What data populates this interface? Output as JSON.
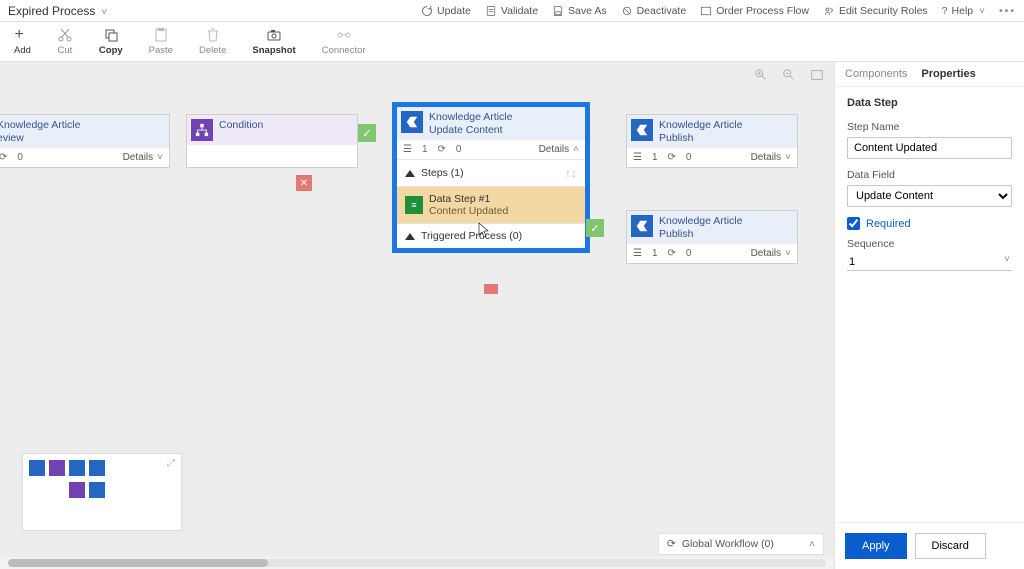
{
  "process": {
    "title": "Expired Process"
  },
  "topbar": {
    "update": "Update",
    "validate": "Validate",
    "saveas": "Save As",
    "deactivate": "Deactivate",
    "orderflow": "Order Process Flow",
    "editroles": "Edit Security Roles",
    "help": "Help"
  },
  "ribbon": {
    "add": "Add",
    "cut": "Cut",
    "copy": "Copy",
    "paste": "Paste",
    "delete": "Delete",
    "snapshot": "Snapshot",
    "connector": "Connector"
  },
  "nodes": {
    "review": {
      "title1": "Knowledge Article",
      "title2": "eview",
      "details": "Details"
    },
    "condition": {
      "title1": "Condition"
    },
    "update": {
      "title1": "Knowledge Article",
      "title2": "Update Content",
      "stepsLabel": "Steps (1)",
      "dataStepTitle": "Data Step #1",
      "dataStepSub": "Content Updated",
      "triggered": "Triggered Process (0)",
      "details": "Details"
    },
    "publish1": {
      "title1": "Knowledge Article",
      "title2": "Publish",
      "details": "Details"
    },
    "publish2": {
      "title1": "Knowledge Article",
      "title2": "Publish",
      "details": "Details"
    },
    "count1": "1",
    "count0": "0"
  },
  "canvas": {
    "globalWorkflow": "Global Workflow (0)"
  },
  "panel": {
    "tabComponents": "Components",
    "tabProperties": "Properties",
    "heading": "Data Step",
    "stepNameLabel": "Step Name",
    "stepNameValue": "Content Updated",
    "dataFieldLabel": "Data Field",
    "dataFieldValue": "Update Content",
    "requiredLabel": "Required",
    "sequenceLabel": "Sequence",
    "sequenceValue": "1",
    "apply": "Apply",
    "discard": "Discard"
  }
}
